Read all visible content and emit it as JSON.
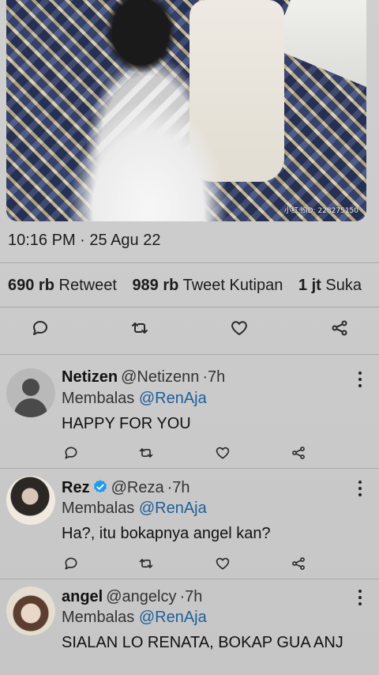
{
  "media": {
    "watermark": "小红书ID: 228275150"
  },
  "tweet": {
    "timestamp": "10:16 PM · 25 Agu 22",
    "stats": [
      {
        "value": "690 rb",
        "label": "Retweet"
      },
      {
        "value": "989 rb",
        "label": "Tweet Kutipan"
      },
      {
        "value": "1 jt",
        "label": "Suka"
      }
    ],
    "actions": [
      "reply-icon",
      "retweet-icon",
      "like-icon",
      "share-icon"
    ]
  },
  "replies": [
    {
      "name": "Netizen",
      "handle": "@Netizenn",
      "time": "7h",
      "verified": false,
      "replying_prefix": "Membalas",
      "replying_to": "@RenAja",
      "text": "HAPPY FOR YOU"
    },
    {
      "name": "Rez",
      "handle": "@Reza",
      "time": "7h",
      "verified": true,
      "replying_prefix": "Membalas",
      "replying_to": "@RenAja",
      "text": "Ha?, itu bokapnya angel kan?"
    },
    {
      "name": "angel",
      "handle": "@angelcy",
      "time": "7h",
      "verified": false,
      "replying_prefix": "Membalas",
      "replying_to": "@RenAja",
      "text": "SIALAN LO RENATA, BOKAP GUA ANJ"
    }
  ],
  "colors": {
    "background": "#c9c9c9",
    "mention": "#1d5e9c",
    "verified": "#1d9bf0"
  }
}
